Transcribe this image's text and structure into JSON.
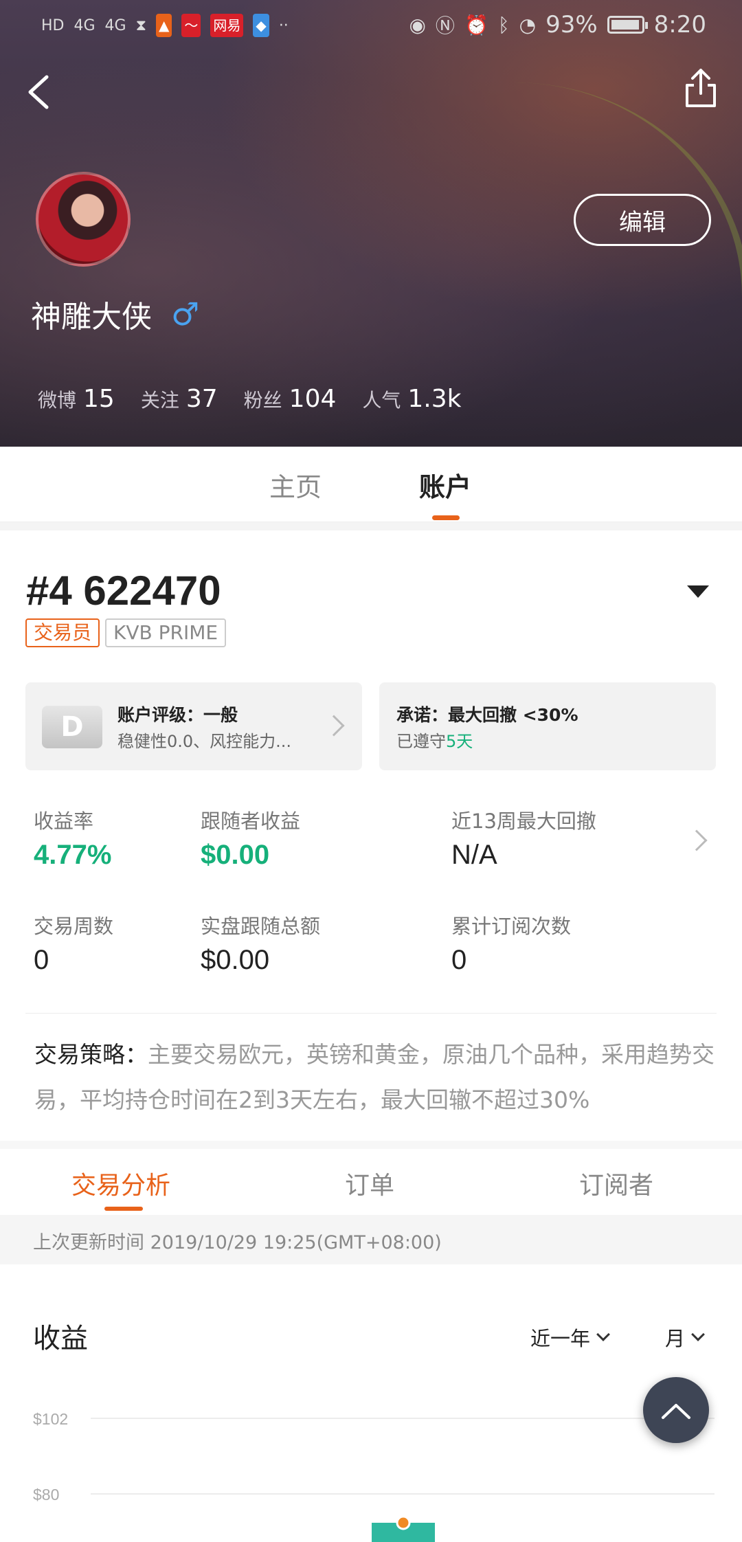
{
  "status_bar": {
    "left_icons": [
      "HD",
      "4G",
      "4G",
      "hourglass-icon",
      "app-icon",
      "app-icon",
      "网易",
      "app-icon",
      "··"
    ],
    "battery": "93%",
    "time": "8:20"
  },
  "profile": {
    "edit_label": "编辑",
    "name": "神雕大侠",
    "gender_symbol": "♂",
    "stats": [
      {
        "label": "微博",
        "value": "15"
      },
      {
        "label": "关注",
        "value": "37"
      },
      {
        "label": "粉丝",
        "value": "104"
      },
      {
        "label": "人气",
        "value": "1.3k"
      }
    ]
  },
  "main_tabs": [
    {
      "label": "主页",
      "active": false
    },
    {
      "label": "账户",
      "active": true
    }
  ],
  "account": {
    "number": "#4 622470",
    "tags": [
      "交易员",
      "KVB PRIME"
    ],
    "rating_card": {
      "badge": "D",
      "title": "账户评级：一般",
      "subtitle": "稳健性0.0、风控能力..."
    },
    "promise_card": {
      "title": "承诺：最大回撤 <30%",
      "sub_prefix": "已遵守",
      "sub_value": "5天"
    },
    "metrics": [
      {
        "label": "收益率",
        "value": "4.77%"
      },
      {
        "label": "跟随者收益",
        "value": "$0.00"
      },
      {
        "label": "近13周最大回撤",
        "value": "N/A"
      },
      {
        "label": "交易周数",
        "value": "0"
      },
      {
        "label": "实盘跟随总额",
        "value": "$0.00"
      },
      {
        "label": "累计订阅次数",
        "value": "0"
      }
    ],
    "strategy_label": "交易策略：",
    "strategy_text": "主要交易欧元，英镑和黄金，原油几个品种，采用趋势交易，平均持仓时间在2到3天左右，最大回辙不超过30%"
  },
  "sub_tabs": [
    {
      "label": "交易分析",
      "active": true
    },
    {
      "label": "订单",
      "active": false
    },
    {
      "label": "订阅者",
      "active": false
    }
  ],
  "update_text": "上次更新时间 2019/10/29 19:25(GMT+08:00)",
  "chart_section": {
    "title": "收益",
    "range_filter": "近一年",
    "period_filter": "月"
  },
  "colors": {
    "accent": "#e8621a",
    "positive": "#16b07a",
    "fab": "#3e4555"
  },
  "chart_data": {
    "type": "bar",
    "title": "收益",
    "yticks": [
      "$102",
      "$80"
    ],
    "ylim": [
      80,
      102
    ],
    "grid": true,
    "partial": true,
    "categories": [
      ""
    ],
    "values": [
      0
    ],
    "marker_color": "#f08a24",
    "bar_color": "#2fb8a0"
  }
}
